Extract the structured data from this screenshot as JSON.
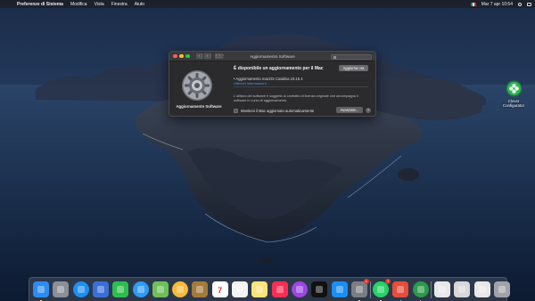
{
  "menubar": {
    "apple_glyph": "",
    "app_name": "Preferenze di Sistema",
    "menus": [
      "Modifica",
      "Vista",
      "Finestra",
      "Aiuto"
    ],
    "clock": "Mar 7 apr 10:54",
    "flag_colors": [
      "#009246",
      "#ffffff",
      "#ce2b37"
    ]
  },
  "window": {
    "title": "Aggiornamento Software",
    "nav_back": "‹",
    "nav_forward": "›",
    "grid_button": "⋮⋮⋮",
    "search_placeholder": "",
    "side_label": "Aggiornamento Software",
    "headline": "È disponibile un aggiornamento per il Mac",
    "update_button": "Aggiorna ora",
    "update_item": "• Aggiornamento macOS Catalina 10.15.4",
    "more_info_link": "Ulteriori informazioni...",
    "note": "L'utilizzo del software è soggetto al contratto di licenza originale che accompagna il software in corso di aggiornamento.",
    "auto_update_label": "Mantieni il Mac aggiornato automaticamente",
    "auto_update_checked": false,
    "advanced_button": "Avanzate...",
    "help_button": "?"
  },
  "desktop_icon": {
    "label_line1": "Clover",
    "label_line2": "Configurator",
    "icon": "clover-icon"
  },
  "dock": {
    "items": [
      {
        "name": "finder",
        "icon": "finder-icon",
        "color": "#2d8cf0",
        "running": true
      },
      {
        "name": "launchpad",
        "icon": "rocket-icon",
        "color": "#8a8f98",
        "running": false
      },
      {
        "name": "safari",
        "icon": "compass-icon",
        "color": "#1f8ef1",
        "running": false
      },
      {
        "name": "photo-editor",
        "icon": "photo-icon",
        "color": "#3a6fd8",
        "running": false
      },
      {
        "name": "facetime",
        "icon": "video-icon",
        "color": "#2dbd4e",
        "running": false
      },
      {
        "name": "messages",
        "icon": "message-bubble-icon",
        "color": "#2f9bf4",
        "running": false
      },
      {
        "name": "maps",
        "icon": "map-icon",
        "color": "#6fbf5a",
        "running": false
      },
      {
        "name": "photos",
        "icon": "photos-flower-icon",
        "color": "#f6b93b",
        "running": false
      },
      {
        "name": "notes-brown",
        "icon": "notebook-icon",
        "color": "#a57a3c",
        "running": false
      },
      {
        "name": "calendar",
        "icon": "calendar-icon",
        "color": "#ffffff",
        "running": false,
        "text": "7"
      },
      {
        "name": "reminders",
        "icon": "list-icon",
        "color": "#f4f4f4",
        "running": false
      },
      {
        "name": "notes",
        "icon": "note-icon",
        "color": "#fbe27a",
        "running": false
      },
      {
        "name": "music",
        "icon": "music-note-icon",
        "color": "#fa2d55",
        "running": false
      },
      {
        "name": "podcasts",
        "icon": "podcast-icon",
        "color": "#9b48e0",
        "running": false
      },
      {
        "name": "tv",
        "icon": "tv-icon",
        "color": "#111111",
        "running": false
      },
      {
        "name": "app-store",
        "icon": "app-store-icon",
        "color": "#1b8ef5",
        "running": false
      },
      {
        "name": "system-preferences",
        "icon": "gear-icon",
        "color": "#7b7e84",
        "running": true,
        "badge": "1"
      },
      {
        "name": "whatsapp",
        "icon": "whatsapp-icon",
        "color": "#25d366",
        "running": true,
        "badge": "1"
      },
      {
        "name": "mail",
        "icon": "mail-icon",
        "color": "#e74c3c",
        "running": true
      },
      {
        "name": "clover-configurator",
        "icon": "clover-icon",
        "color": "#2b9a4a",
        "running": true
      },
      {
        "name": "screenshot",
        "icon": "window-icon",
        "color": "#e8e8e8",
        "running": false
      },
      {
        "name": "terminal",
        "icon": "terminal-icon",
        "color": "#d9d9d9",
        "running": false
      },
      {
        "name": "finder-window",
        "icon": "window-icon",
        "color": "#e8e8e8",
        "running": false
      },
      {
        "name": "trash",
        "icon": "trash-icon",
        "color": "#a0a4aa",
        "running": false
      }
    ]
  }
}
